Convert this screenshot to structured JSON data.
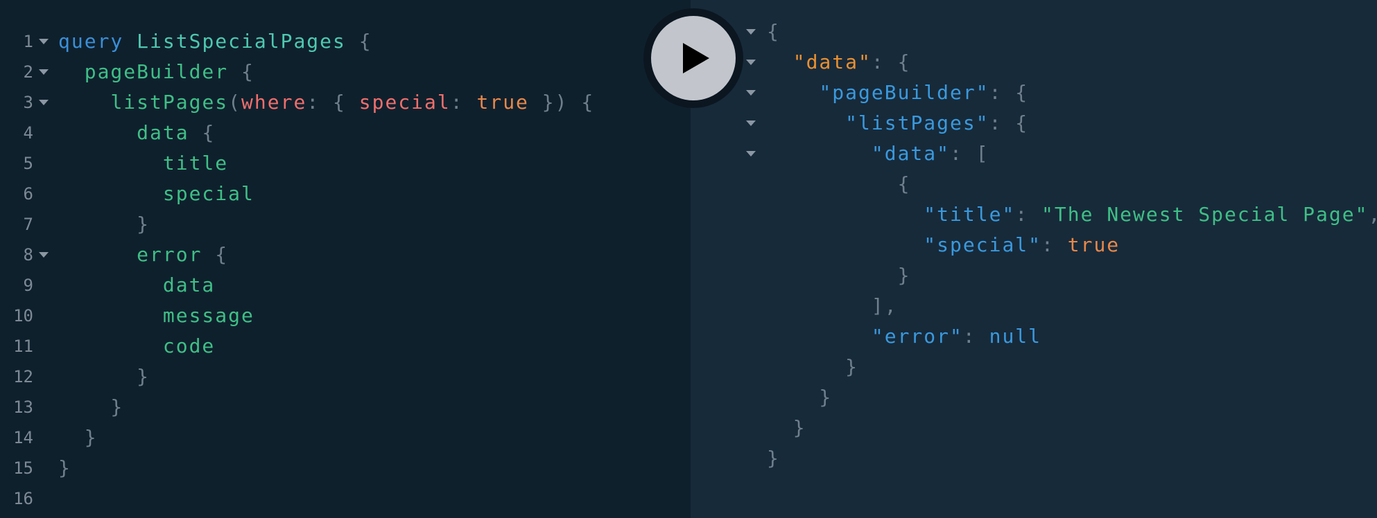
{
  "editor": {
    "lines": [
      {
        "num": "1",
        "fold": true,
        "tokens": [
          {
            "t": "query",
            "c": "kw"
          },
          {
            "t": " ",
            "c": "punct"
          },
          {
            "t": "ListSpecialPages",
            "c": "name"
          },
          {
            "t": " {",
            "c": "punct"
          }
        ]
      },
      {
        "num": "2",
        "fold": true,
        "tokens": [
          {
            "t": "  ",
            "c": "punct"
          },
          {
            "t": "pageBuilder",
            "c": "field"
          },
          {
            "t": " {",
            "c": "punct"
          }
        ]
      },
      {
        "num": "3",
        "fold": true,
        "tokens": [
          {
            "t": "    ",
            "c": "punct"
          },
          {
            "t": "listPages",
            "c": "field"
          },
          {
            "t": "(",
            "c": "punct"
          },
          {
            "t": "where",
            "c": "arg"
          },
          {
            "t": ": { ",
            "c": "punct"
          },
          {
            "t": "special",
            "c": "arg"
          },
          {
            "t": ": ",
            "c": "punct"
          },
          {
            "t": "true",
            "c": "bool"
          },
          {
            "t": " }) {",
            "c": "punct"
          }
        ]
      },
      {
        "num": "4",
        "fold": false,
        "tokens": [
          {
            "t": "      ",
            "c": "punct"
          },
          {
            "t": "data",
            "c": "field"
          },
          {
            "t": " {",
            "c": "punct"
          }
        ]
      },
      {
        "num": "5",
        "fold": false,
        "tokens": [
          {
            "t": "        ",
            "c": "punct"
          },
          {
            "t": "title",
            "c": "field"
          }
        ]
      },
      {
        "num": "6",
        "fold": false,
        "tokens": [
          {
            "t": "        ",
            "c": "punct"
          },
          {
            "t": "special",
            "c": "field"
          }
        ]
      },
      {
        "num": "7",
        "fold": false,
        "tokens": [
          {
            "t": "      }",
            "c": "punct"
          }
        ]
      },
      {
        "num": "8",
        "fold": true,
        "tokens": [
          {
            "t": "      ",
            "c": "punct"
          },
          {
            "t": "error",
            "c": "field"
          },
          {
            "t": " {",
            "c": "punct"
          }
        ]
      },
      {
        "num": "9",
        "fold": false,
        "tokens": [
          {
            "t": "        ",
            "c": "punct"
          },
          {
            "t": "data",
            "c": "field"
          }
        ]
      },
      {
        "num": "10",
        "fold": false,
        "tokens": [
          {
            "t": "        ",
            "c": "punct"
          },
          {
            "t": "message",
            "c": "field"
          }
        ]
      },
      {
        "num": "11",
        "fold": false,
        "tokens": [
          {
            "t": "        ",
            "c": "punct"
          },
          {
            "t": "code",
            "c": "field"
          }
        ]
      },
      {
        "num": "12",
        "fold": false,
        "tokens": [
          {
            "t": "      }",
            "c": "punct"
          }
        ]
      },
      {
        "num": "13",
        "fold": false,
        "tokens": [
          {
            "t": "    }",
            "c": "punct"
          }
        ]
      },
      {
        "num": "14",
        "fold": false,
        "tokens": [
          {
            "t": "  }",
            "c": "punct"
          }
        ]
      },
      {
        "num": "15",
        "fold": false,
        "tokens": [
          {
            "t": "}",
            "c": "punct"
          }
        ]
      },
      {
        "num": "16",
        "fold": false,
        "tokens": []
      }
    ]
  },
  "run_button": {
    "label": "Execute Query"
  },
  "result": {
    "lines": [
      {
        "fold": true,
        "tokens": [
          {
            "t": "{",
            "c": "punct"
          }
        ]
      },
      {
        "fold": true,
        "tokens": [
          {
            "t": "  ",
            "c": "punct"
          },
          {
            "t": "\"data\"",
            "c": "key-orange"
          },
          {
            "t": ": {",
            "c": "punct"
          }
        ]
      },
      {
        "fold": true,
        "tokens": [
          {
            "t": "    ",
            "c": "punct"
          },
          {
            "t": "\"pageBuilder\"",
            "c": "key-blue"
          },
          {
            "t": ": {",
            "c": "punct"
          }
        ]
      },
      {
        "fold": true,
        "tokens": [
          {
            "t": "      ",
            "c": "punct"
          },
          {
            "t": "\"listPages\"",
            "c": "key-blue"
          },
          {
            "t": ": {",
            "c": "punct"
          }
        ]
      },
      {
        "fold": true,
        "tokens": [
          {
            "t": "        ",
            "c": "punct"
          },
          {
            "t": "\"data\"",
            "c": "key-blue"
          },
          {
            "t": ": [",
            "c": "punct"
          }
        ]
      },
      {
        "fold": false,
        "tokens": [
          {
            "t": "          {",
            "c": "punct"
          }
        ]
      },
      {
        "fold": false,
        "tokens": [
          {
            "t": "            ",
            "c": "punct"
          },
          {
            "t": "\"title\"",
            "c": "key-blue"
          },
          {
            "t": ": ",
            "c": "punct"
          },
          {
            "t": "\"The Newest Special Page\"",
            "c": "str"
          },
          {
            "t": ",",
            "c": "punct"
          }
        ]
      },
      {
        "fold": false,
        "tokens": [
          {
            "t": "            ",
            "c": "punct"
          },
          {
            "t": "\"special\"",
            "c": "key-blue"
          },
          {
            "t": ": ",
            "c": "punct"
          },
          {
            "t": "true",
            "c": "bool"
          }
        ]
      },
      {
        "fold": false,
        "tokens": [
          {
            "t": "          }",
            "c": "punct"
          }
        ]
      },
      {
        "fold": false,
        "tokens": [
          {
            "t": "        ],",
            "c": "punct"
          }
        ]
      },
      {
        "fold": false,
        "tokens": [
          {
            "t": "        ",
            "c": "punct"
          },
          {
            "t": "\"error\"",
            "c": "key-blue"
          },
          {
            "t": ": ",
            "c": "punct"
          },
          {
            "t": "null",
            "c": "null"
          }
        ]
      },
      {
        "fold": false,
        "tokens": [
          {
            "t": "      }",
            "c": "punct"
          }
        ]
      },
      {
        "fold": false,
        "tokens": [
          {
            "t": "    }",
            "c": "punct"
          }
        ]
      },
      {
        "fold": false,
        "tokens": [
          {
            "t": "  }",
            "c": "punct"
          }
        ]
      },
      {
        "fold": false,
        "tokens": [
          {
            "t": "}",
            "c": "punct"
          }
        ]
      }
    ]
  }
}
